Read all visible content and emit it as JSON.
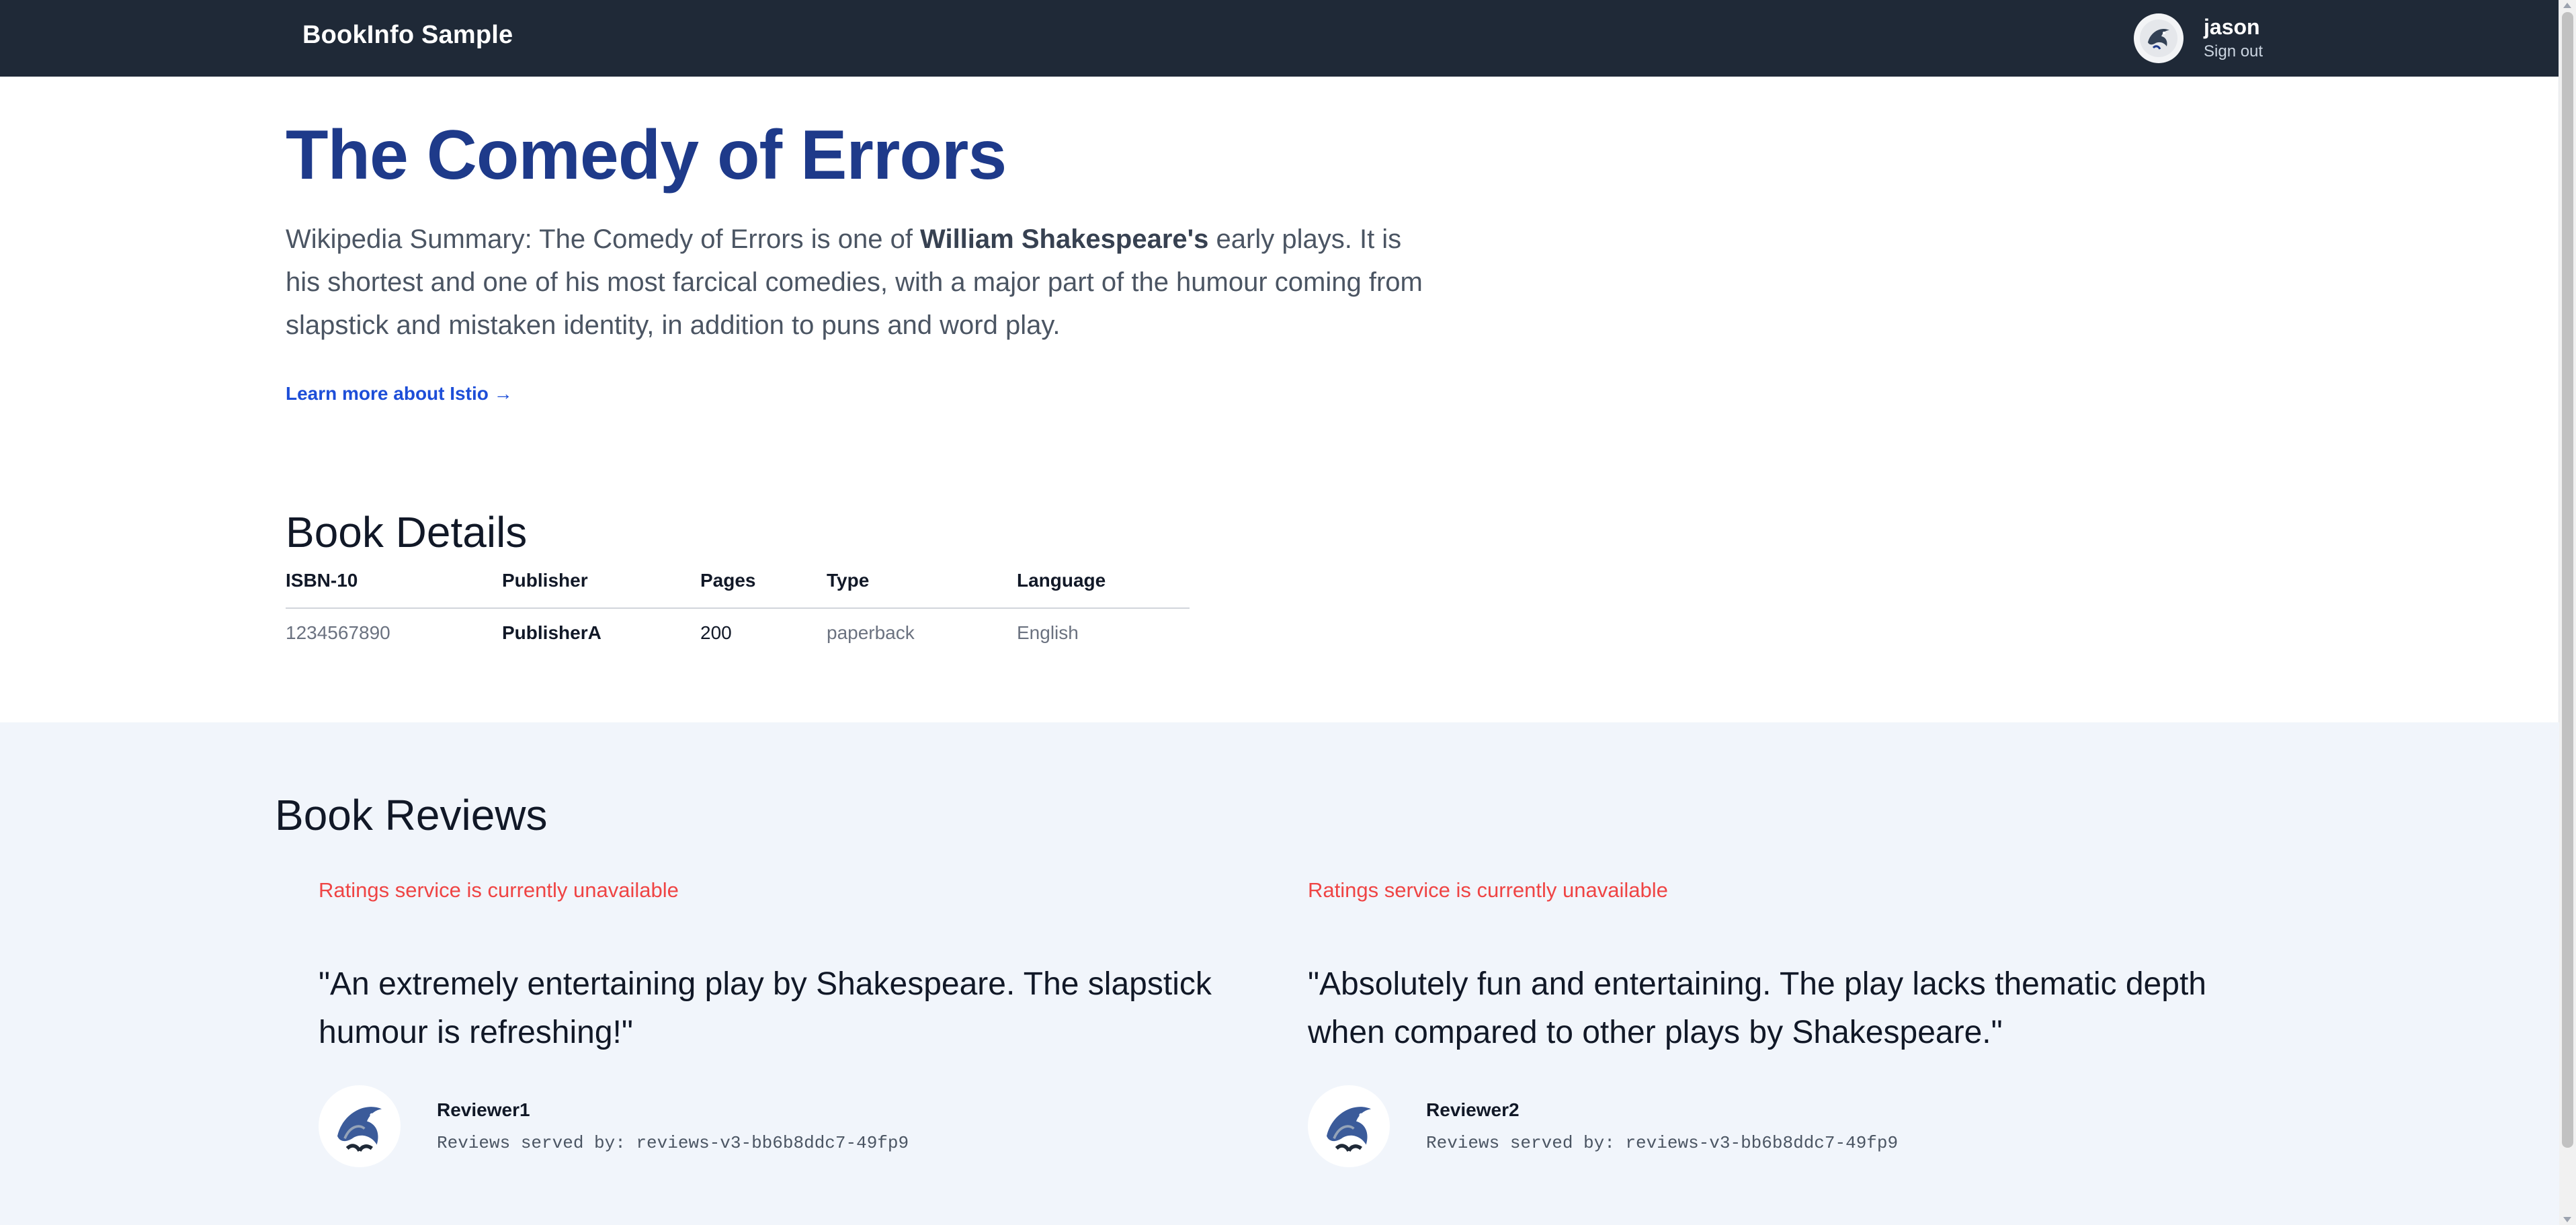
{
  "header": {
    "brand": "BookInfo Sample",
    "user_name": "jason",
    "signout_label": "Sign out",
    "avatar_icon": "dolphin-avatar-icon"
  },
  "hero": {
    "title": "The Comedy of Errors",
    "summary_prefix": "Wikipedia Summary: The Comedy of Errors is one of ",
    "summary_bold": "William Shakespeare's",
    "summary_suffix": " early plays. It is his shortest and one of his most farcical comedies, with a major part of the humour coming from slapstick and mistaken identity, in addition to puns and word play.",
    "learn_more": "Learn more about Istio →"
  },
  "details": {
    "title": "Book Details",
    "columns": [
      "ISBN-10",
      "Publisher",
      "Pages",
      "Type",
      "Language"
    ],
    "row": [
      "1234567890",
      "PublisherA",
      "200",
      "paperback",
      "English"
    ]
  },
  "reviews": {
    "title": "Book Reviews",
    "items": [
      {
        "rating_status": "Ratings service is currently unavailable",
        "text": "\"An extremely entertaining play by Shakespeare. The slapstick humour is refreshing!\"",
        "reviewer": "Reviewer1",
        "served_by": "Reviews served by: reviews-v3-bb6b8ddc7-49fp9"
      },
      {
        "rating_status": "Ratings service is currently unavailable",
        "text": "\"Absolutely fun and entertaining. The play lacks thematic depth when compared to other plays by Shakespeare.\"",
        "reviewer": "Reviewer2",
        "served_by": "Reviews served by: reviews-v3-bb6b8ddc7-49fp9"
      }
    ]
  },
  "colors": {
    "header_bg": "#1f2937",
    "title": "#1e3a8a",
    "link": "#1d4ed8",
    "error": "#ef4444",
    "reviews_bg": "#f1f5fb"
  }
}
